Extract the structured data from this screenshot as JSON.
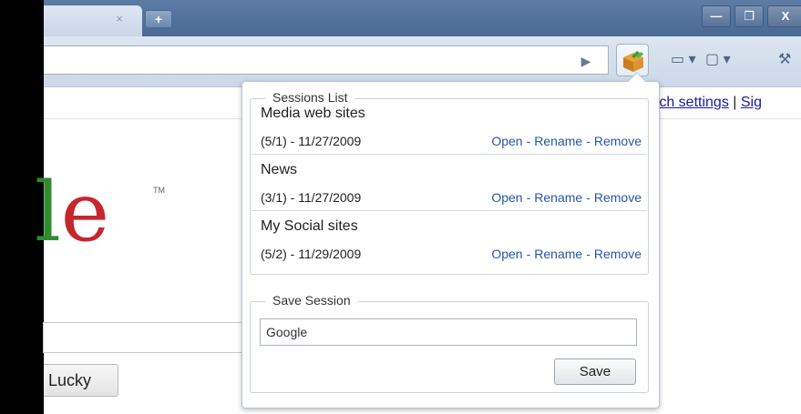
{
  "browser": {
    "tab_close_glyph": "×",
    "new_tab_glyph": "+",
    "window_controls": {
      "minimize": "—",
      "maximize": "❐",
      "close": "X"
    },
    "go_glyph": "▶",
    "page_icon_glyph": "▭ ▾",
    "page_menu_glyph": "▢ ▾",
    "wrench_glyph": "⚒"
  },
  "page": {
    "top_links": {
      "search_settings": "rch settings",
      "separator": " | ",
      "sign": "Sig"
    },
    "logo": {
      "l": "l",
      "e": "e",
      "tm": "TM"
    },
    "lucky_button": "Lucky"
  },
  "popup": {
    "sessions_legend": "Sessions List",
    "sessions": [
      {
        "name": "Media web sites",
        "date": "(5/1) - 11/27/2009"
      },
      {
        "name": "News",
        "date": "(3/1) - 11/27/2009"
      },
      {
        "name": "My Social sites",
        "date": "(5/2) - 11/29/2009"
      }
    ],
    "actions": {
      "open": "Open",
      "rename": "Rename",
      "remove": "Remove",
      "sep": "-"
    },
    "save_legend": "Save Session",
    "save_input_value": "Google",
    "save_button": "Save"
  },
  "colors": {
    "link": "#2757a6",
    "logo_green": "#2e8b2e",
    "logo_red": "#c6262e",
    "tabstrip": "#5d7ba3"
  }
}
